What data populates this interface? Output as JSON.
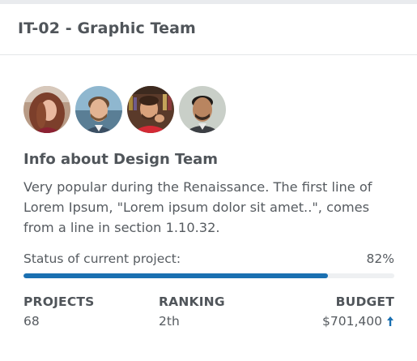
{
  "header": {
    "title": "IT-02 - Graphic Team"
  },
  "team": {
    "members": [
      {
        "name": "team-member-avatar-1"
      },
      {
        "name": "team-member-avatar-2"
      },
      {
        "name": "team-member-avatar-3"
      },
      {
        "name": "team-member-avatar-4"
      }
    ],
    "info_title": "Info about Design Team",
    "info_text": "Very popular during the Renaissance. The first line of Lorem Ipsum, \"Lorem ipsum dolor sit amet..\", comes from a line in section 1.10.32."
  },
  "status": {
    "label": "Status of current project:",
    "percent_text": "82%",
    "progress": 0.82
  },
  "stats": {
    "projects_label": "PROJECTS",
    "projects_value": "68",
    "ranking_label": "RANKING",
    "ranking_value": "2th",
    "budget_label": "BUDGET",
    "budget_value": "$701,400",
    "budget_trend_icon": "arrow-up-icon"
  },
  "colors": {
    "accent": "#1a70b1",
    "progress_track": "#eef0f2"
  }
}
